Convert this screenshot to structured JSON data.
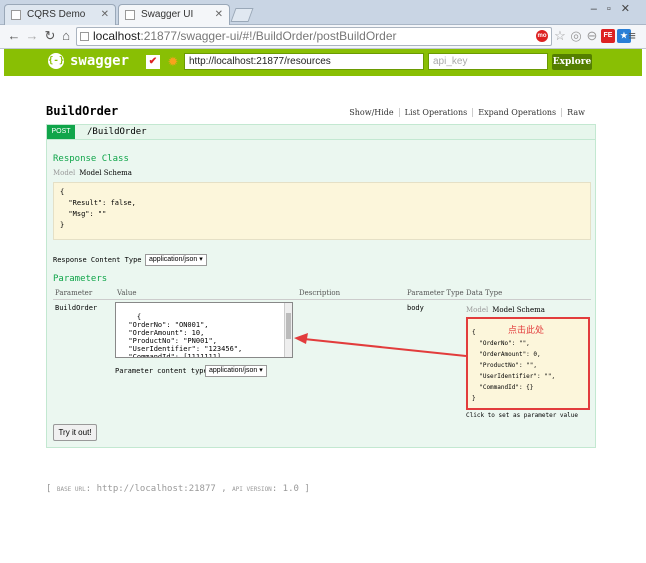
{
  "browser": {
    "tabs": [
      {
        "title": "CQRS Demo"
      },
      {
        "title": "Swagger UI"
      }
    ],
    "url_host": "localhost",
    "url_rest": ":21877/swagger-ui/#!/BuildOrder/postBuildOrder",
    "ext_labels": [
      "mo",
      "FE"
    ]
  },
  "swagger": {
    "logo": "swagger",
    "logo_mark": "{-}",
    "base_url_value": "http://localhost:21877/resources",
    "api_key_placeholder": "api_key",
    "explore_label": "Explore"
  },
  "resource": {
    "title": "BuildOrder",
    "ops": [
      "Show/Hide",
      "List Operations",
      "Expand Operations",
      "Raw"
    ],
    "method": "POST",
    "path": "/BuildOrder"
  },
  "response": {
    "heading": "Response Class",
    "tab_model": "Model",
    "tab_schema": "Model Schema",
    "schema": "{\n  \"Result\": false,\n  \"Msg\": \"\"\n}",
    "content_type_label": "Response Content Type",
    "content_type_value": "application/json ▾"
  },
  "parameters": {
    "heading": "Parameters",
    "columns": [
      "Parameter",
      "Value",
      "Description",
      "Parameter Type",
      "Data Type"
    ],
    "row": {
      "name": "BuildOrder",
      "value": "{\n  \"OrderNo\": \"ON001\",\n  \"OrderAmount\": 10,\n  \"ProductNo\": \"PN001\",\n  \"UserIdentifier\": \"123456\",\n  \"CommandId\": [1111111]\n}",
      "param_type": "body",
      "tab_model": "Model",
      "tab_schema": "Model Schema",
      "data_schema": "{\n  \"OrderNo\": \"\",\n  \"OrderAmount\": 0,\n  \"ProductNo\": \"\",\n  \"UserIdentifier\": \"\",\n  \"CommandId\": {}\n}",
      "annotation": "点击此处",
      "click_hint": "Click to set as parameter value",
      "content_type_label": "Parameter content type:",
      "content_type_value": "application/json ▾"
    },
    "try_label": "Try it out!"
  },
  "footer": {
    "base_label": "BASE URL",
    "base_value": ": http://localhost:21877 ,",
    "api_label": "API VERSION",
    "api_value": ": 1.0 ]",
    "open": "["
  },
  "colors": {
    "swagger_green": "#89bf04",
    "post_green": "#10a54a",
    "annotation_red": "#e23c3c"
  }
}
